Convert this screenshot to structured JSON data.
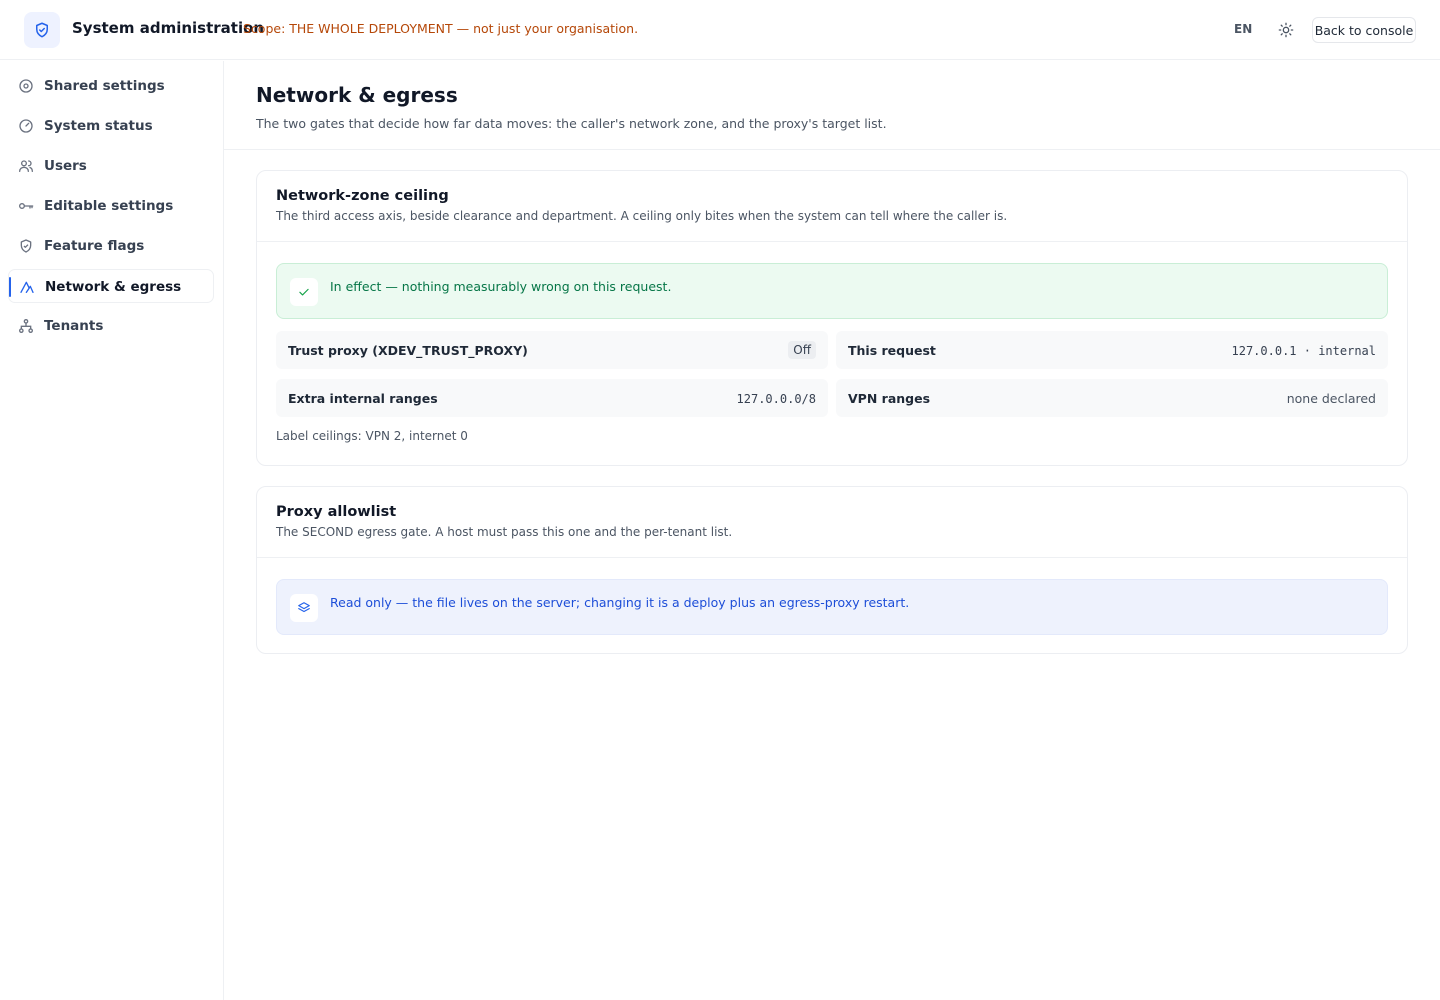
{
  "header": {
    "title": "System administration",
    "scope_notice": "Scope: THE WHOLE DEPLOYMENT — not just your organisation.",
    "language": "EN",
    "back_label": "Back to console",
    "logo_icon": "shield-check-icon",
    "theme_icon": "sun-icon"
  },
  "sidebar": {
    "items": [
      {
        "label": "Shared settings",
        "icon": "settings-icon"
      },
      {
        "label": "System status",
        "icon": "gauge-icon"
      },
      {
        "label": "Users",
        "icon": "users-icon"
      },
      {
        "label": "Editable settings",
        "icon": "key-icon"
      },
      {
        "label": "Feature flags",
        "icon": "shield-icon"
      },
      {
        "label": "Network & egress",
        "icon": "network-icon",
        "active": true
      },
      {
        "label": "Tenants",
        "icon": "tenants-icon"
      }
    ]
  },
  "page": {
    "title": "Network & egress",
    "subtitle": "The two gates that decide how far data moves: the caller's network zone, and the proxy's target list."
  },
  "zone_card": {
    "title": "Network-zone ceiling",
    "subtitle": "The third access axis, beside clearance and department. A ceiling only bites when the system can tell where the caller is.",
    "status": "In effect — nothing measurably wrong on this request.",
    "fields": {
      "trust_proxy_label": "Trust proxy (XDEV_TRUST_PROXY)",
      "trust_proxy_value": "Off",
      "this_request_label": "This request",
      "this_request_value": "127.0.0.1 · internal",
      "extra_ranges_label": "Extra internal ranges",
      "extra_ranges_value": "127.0.0.0/8",
      "vpn_ranges_label": "VPN ranges",
      "vpn_ranges_value": "none declared"
    },
    "footnote": "Label ceilings: VPN 2, internet 0"
  },
  "proxy_card": {
    "title": "Proxy allowlist",
    "subtitle": "The SECOND egress gate. A host must pass this one and the per-tenant list.",
    "notice": "Read only — the file lives on the server; changing it is a deploy plus an egress-proxy restart."
  },
  "colors": {
    "accent": "#2563eb",
    "scope_warning": "#b54708",
    "success_text": "#067647",
    "success_bg": "#ecfaf1",
    "info_text": "#1d4ed8",
    "info_bg": "#eef2fd"
  }
}
